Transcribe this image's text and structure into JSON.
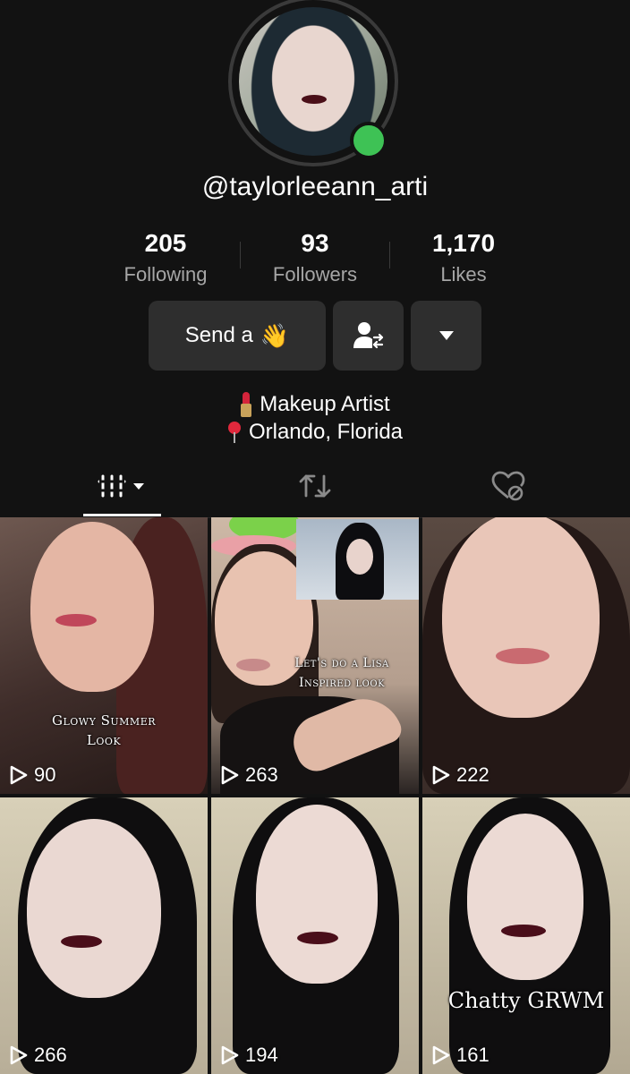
{
  "profile": {
    "username": "@taylorleeann_arti",
    "stats": [
      {
        "value": "205",
        "label": "Following"
      },
      {
        "value": "93",
        "label": "Followers"
      },
      {
        "value": "1,170",
        "label": "Likes"
      }
    ],
    "actions": {
      "send_label": "Send a",
      "send_emoji": "👋",
      "follow_icon": "add-friend-icon",
      "more_icon": "caret-down-icon"
    },
    "bio": [
      {
        "icon": "lipstick-icon",
        "text": "Makeup Artist"
      },
      {
        "icon": "pin-icon",
        "text": "Orlando, Florida"
      }
    ],
    "online": true,
    "online_color": "#3ec255"
  },
  "tabs": [
    {
      "icon": "videos-grid-icon",
      "active": true
    },
    {
      "icon": "repost-icon",
      "active": false
    },
    {
      "icon": "liked-hidden-icon",
      "active": false
    }
  ],
  "videos": [
    {
      "views": "90",
      "caption_line1": "Glowy Summer",
      "caption_line2": "Look"
    },
    {
      "views": "263",
      "caption_line1": "Let's do a Lisa",
      "caption_line2": "Inspired look"
    },
    {
      "views": "222",
      "caption_line1": "",
      "caption_line2": ""
    },
    {
      "views": "266",
      "caption_line1": "",
      "caption_line2": ""
    },
    {
      "views": "194",
      "caption_line1": "",
      "caption_line2": ""
    },
    {
      "views": "161",
      "caption_line1": "Chatty GRWM",
      "caption_line2": ""
    }
  ],
  "colors": {
    "background": "#121212",
    "button_bg": "#2e2e2e",
    "secondary_text": "#a6a6a6"
  }
}
